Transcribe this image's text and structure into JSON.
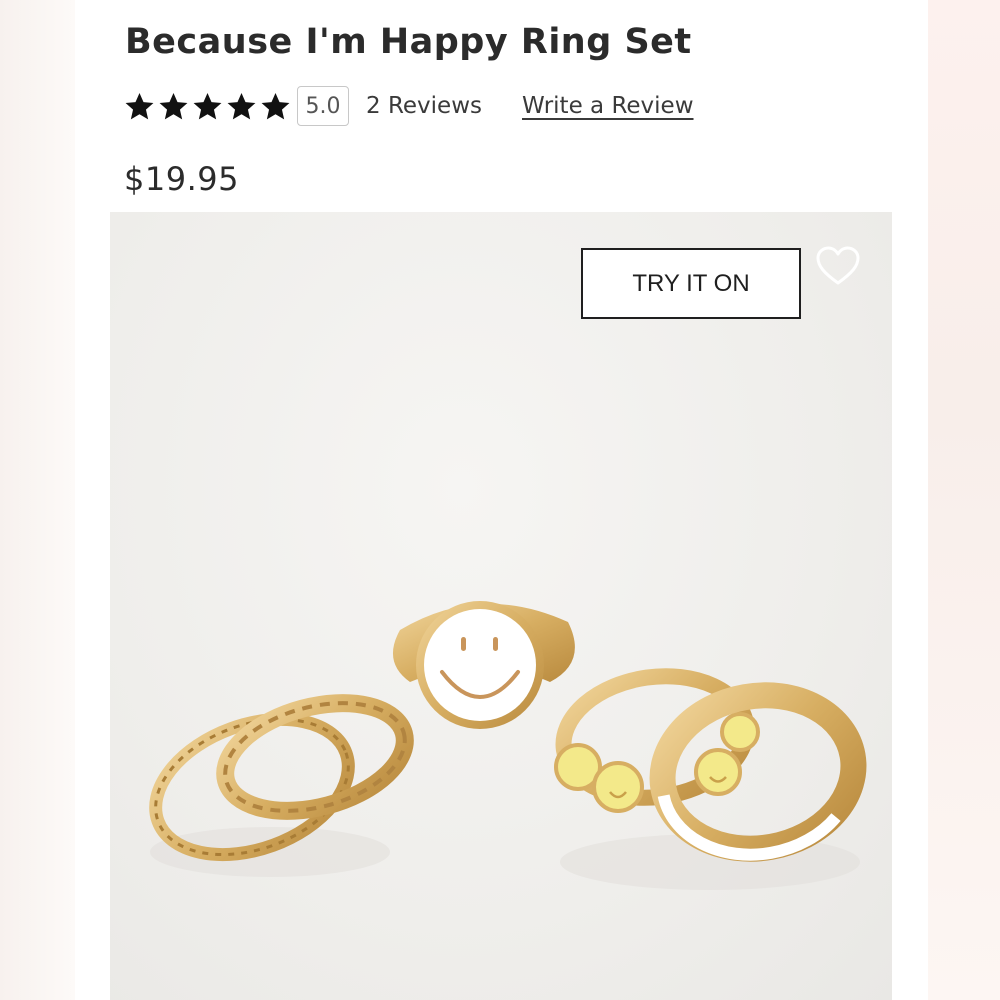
{
  "product": {
    "title": "Because I'm Happy Ring Set",
    "rating_value": "5.0",
    "stars_filled": 5,
    "stars_total": 5,
    "reviews_text": "2 Reviews",
    "write_review_label": "Write a Review",
    "price": "$19.95"
  },
  "image": {
    "try_on_label": "TRY IT ON",
    "favorite_icon": "heart-outline-icon"
  },
  "colors": {
    "text_primary": "#2b2b2b",
    "gold": "#d9b46a",
    "enamel_white": "#ffffff",
    "enamel_yellow": "#f3e98a"
  }
}
